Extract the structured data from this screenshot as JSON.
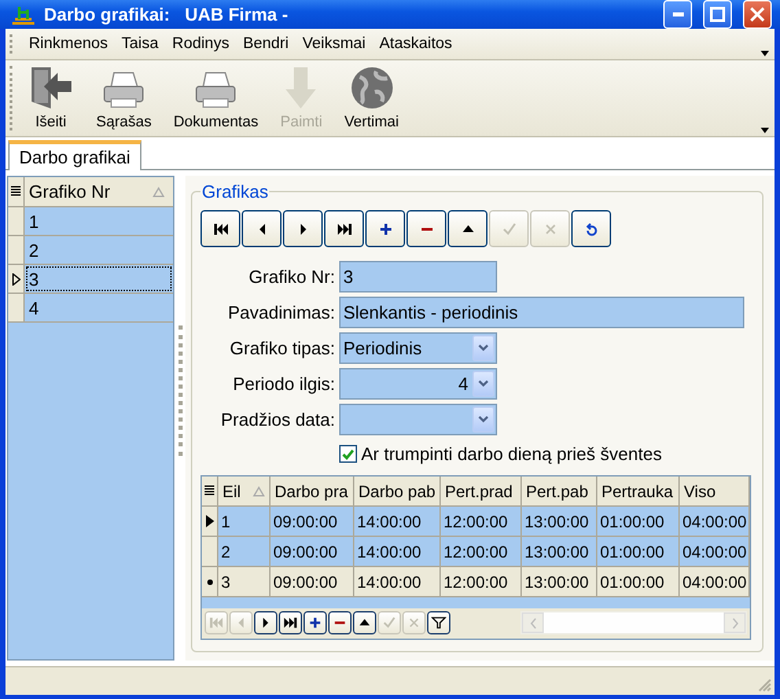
{
  "window": {
    "title": "Darbo grafikai:   UAB Firma -"
  },
  "menu": [
    "Rinkmenos",
    "Taisa",
    "Rodinys",
    "Bendri",
    "Veiksmai",
    "Ataskaitos"
  ],
  "toolbar": [
    {
      "kind": "exit",
      "label": "Išeiti",
      "disabled": false
    },
    {
      "kind": "printer",
      "label": "Sąrašas",
      "disabled": false
    },
    {
      "kind": "printer",
      "label": "Dokumentas",
      "disabled": false
    },
    {
      "kind": "down",
      "label": "Paimti",
      "disabled": true
    },
    {
      "kind": "globe",
      "label": "Vertimai",
      "disabled": false
    }
  ],
  "tabs": [
    {
      "label": "Darbo grafikai",
      "selected": true
    }
  ],
  "list": {
    "column": "Grafiko Nr",
    "rows": [
      {
        "value": "1",
        "current": false
      },
      {
        "value": "2",
        "current": false
      },
      {
        "value": "3",
        "current": true
      },
      {
        "value": "4",
        "current": false
      }
    ]
  },
  "group": {
    "title": "Grafikas",
    "navigator": [
      {
        "kind": "first",
        "disabled": false
      },
      {
        "kind": "prev",
        "disabled": false
      },
      {
        "kind": "next",
        "disabled": false
      },
      {
        "kind": "last",
        "disabled": false
      },
      {
        "kind": "add",
        "disabled": false
      },
      {
        "kind": "delete",
        "disabled": false
      },
      {
        "kind": "up",
        "disabled": false
      },
      {
        "kind": "post",
        "disabled": true
      },
      {
        "kind": "cancel",
        "disabled": true
      },
      {
        "kind": "refresh",
        "disabled": false
      }
    ],
    "fields": [
      {
        "kind": "short",
        "label": "Grafiko Nr:",
        "value": "3"
      },
      {
        "kind": "wide",
        "label": "Pavadinimas:",
        "value": "Slenkantis - periodinis"
      },
      {
        "kind": "combo",
        "label": "Grafiko tipas:",
        "value": "Periodinis"
      },
      {
        "kind": "spin",
        "label": "Periodo ilgis:",
        "value": "4"
      },
      {
        "kind": "combo",
        "label": "Pradžios data:"
      }
    ],
    "checkbox": {
      "label": "Ar trumpinti darbo dieną prieš šventes",
      "checked": true
    },
    "table": {
      "columns": [
        "Eil",
        "Darbo pra",
        "Darbo pab",
        "Pert.prad",
        "Pert.pab",
        "Pertrauka",
        "Viso"
      ],
      "rows": [
        {
          "current": true,
          "editing": false,
          "selected": true,
          "cells": [
            "1",
            "09:00:00",
            "14:00:00",
            "12:00:00",
            "13:00:00",
            "01:00:00",
            "04:00:00"
          ]
        },
        {
          "current": false,
          "editing": false,
          "selected": true,
          "cells": [
            "2",
            "09:00:00",
            "14:00:00",
            "12:00:00",
            "13:00:00",
            "01:00:00",
            "04:00:00"
          ]
        },
        {
          "current": false,
          "editing": true,
          "selected": false,
          "cells": [
            "3",
            "09:00:00",
            "14:00:00",
            "12:00:00",
            "13:00:00",
            "01:00:00",
            "04:00:00"
          ]
        }
      ],
      "navigator": [
        {
          "kind": "first",
          "disabled": true
        },
        {
          "kind": "prev",
          "disabled": true
        },
        {
          "kind": "next",
          "disabled": false
        },
        {
          "kind": "last",
          "disabled": false
        },
        {
          "kind": "add",
          "disabled": false
        },
        {
          "kind": "delete",
          "disabled": false
        },
        {
          "kind": "up",
          "disabled": false
        },
        {
          "kind": "post",
          "disabled": true
        },
        {
          "kind": "cancel",
          "disabled": true
        },
        {
          "kind": "filter",
          "disabled": false
        }
      ]
    }
  }
}
